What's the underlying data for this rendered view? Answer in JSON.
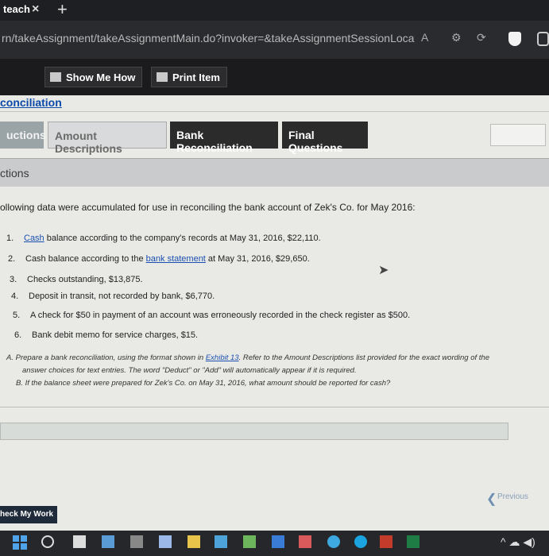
{
  "browser": {
    "tab_title": "teach",
    "tab_close": "×",
    "new_tab": "+",
    "url": "rn/takeAssignment/takeAssignmentMain.do?invoker=&takeAssignmentSessionLocator..."
  },
  "toolbar": {
    "show_me_how": "Show Me How",
    "print_item": "Print Item"
  },
  "page_title": "conciliation",
  "tabs": [
    {
      "label": "uctions"
    },
    {
      "label": "Amount Descriptions"
    },
    {
      "label": "Bank Reconciliation"
    },
    {
      "label": "Final Questions"
    }
  ],
  "section": {
    "title": "ctions",
    "intro": "ollowing data were accumulated for use in reconciling the bank account of Zek's Co. for May 2016:"
  },
  "items": [
    {
      "num": "1.",
      "link": "Cash",
      "text": " balance according to the company's records at May 31, 2016, $22,110."
    },
    {
      "num": "2.",
      "pre": "Cash balance according to the ",
      "link": "bank statement",
      "text": " at May 31, 2016, $29,650."
    },
    {
      "num": "3.",
      "text": "Checks outstanding, $13,875."
    },
    {
      "num": "4.",
      "text": "Deposit in transit, not recorded by bank, $6,770."
    },
    {
      "num": "5.",
      "text": "A check for $50 in payment of an account was erroneously recorded in the check register as $500."
    },
    {
      "num": "6.",
      "text": "Bank debit memo for service charges, $15."
    }
  ],
  "instructions": {
    "a_prefix": "A. Prepare a bank reconciliation, using the format shown in ",
    "a_link": "Exhibit 13",
    "a_suffix": ". Refer to the Amount Descriptions list provided for the exact wording of the",
    "a_line2": "answer choices for text entries. The word \"Deduct\" or \"Add\" will automatically appear if it is required.",
    "b": "B. If the balance sheet were prepared for Zek's Co. on May 31, 2016, what amount should be reported for cash?"
  },
  "buttons": {
    "previous": "Previous",
    "check_my_work": "heck My Work"
  }
}
